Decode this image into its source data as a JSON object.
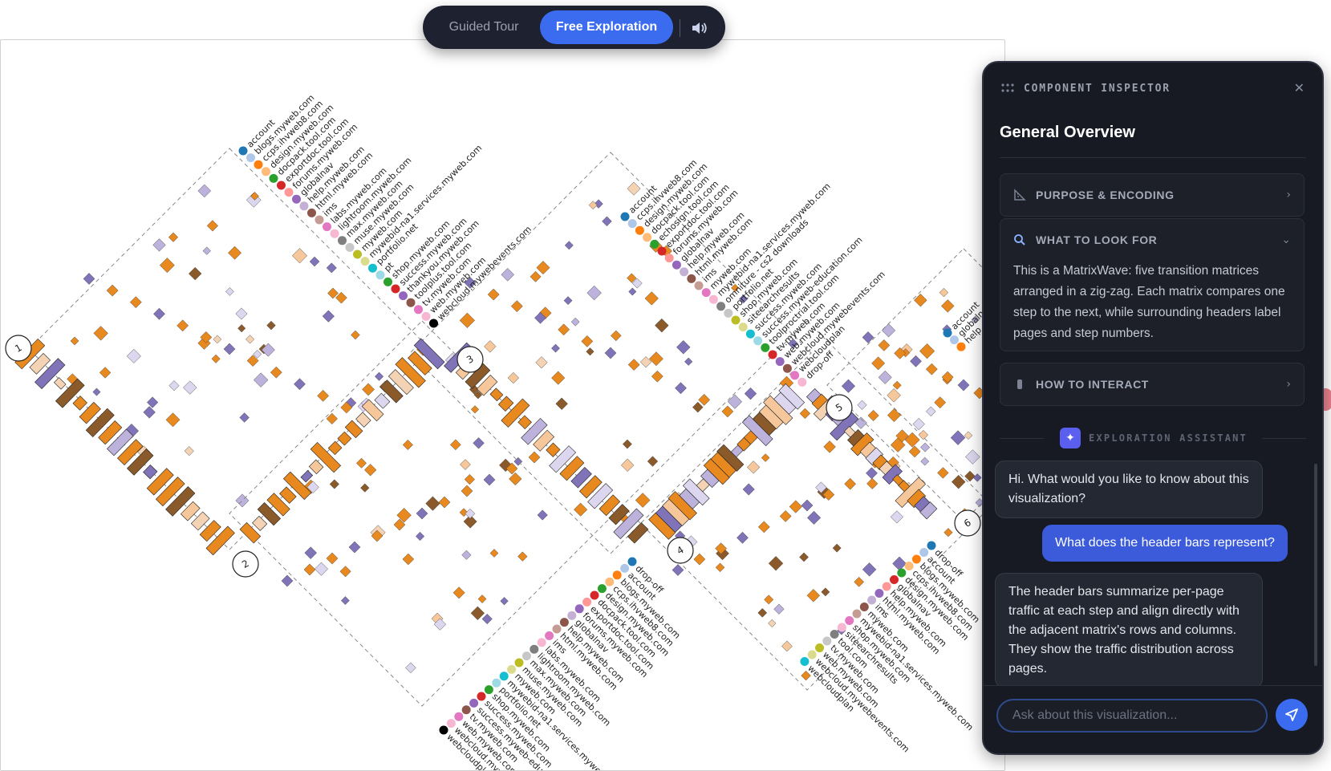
{
  "mode_switch": {
    "guided_label": "Guided Tour",
    "free_label": "Free Exploration",
    "active": "Free Exploration",
    "sound_icon": "speaker-icon"
  },
  "inspector": {
    "title": "COMPONENT INSPECTOR",
    "heading": "General Overview",
    "sections": [
      {
        "label": "PURPOSE & ENCODING",
        "icon": "ruler-icon",
        "expanded": false
      },
      {
        "label": "WHAT TO LOOK FOR",
        "icon": "search-icon",
        "expanded": true,
        "body": "This is a MatrixWave: five transition matrices arranged in a zig-zag. Each matrix compares one step to the next, while surrounding headers label pages and step numbers."
      },
      {
        "label": "HOW TO INTERACT",
        "icon": "hand-icon",
        "expanded": false
      }
    ],
    "assistant_label": "EXPLORATION ASSISTANT",
    "messages": [
      {
        "role": "assistant",
        "text": "Hi. What would you like to know about this visualization?"
      },
      {
        "role": "user",
        "text": "What does the header bars represent?"
      },
      {
        "role": "assistant",
        "text": "The header bars summarize per-page traffic at each step and align directly with the adjacent matrix's rows and columns. They show the traffic distribution across pages."
      }
    ],
    "input_placeholder": "Ask about this visualization..."
  },
  "visualization": {
    "type": "MatrixWave",
    "step_numbers": [
      "1",
      "2",
      "3",
      "4",
      "5",
      "6"
    ],
    "page_lists": [
      [
        "account",
        "blogs.myweb.com",
        "ccps.ihvweb8.com",
        "design.myweb.com",
        "docpack.tool.com",
        "exportdoc.tool.com",
        "forums.myweb.com",
        "globalnav",
        "help.myweb.com",
        "html.myweb.com",
        "ims",
        "labs.myweb.com",
        "lightroom.myweb.com",
        "max.myweb.com",
        "muse.myweb.com",
        "myweb.com",
        "mywebid-na1.services.myweb.com",
        "portfolio.net",
        "pt",
        "shop.myweb.com",
        "success.myweb.com",
        "thankyou.myweb.com",
        "toolplus.tool.com",
        "tv.myweb.com",
        "web.myweb.com",
        "webcloud.mywebevents.com"
      ],
      [
        "account",
        "ccps.ihvweb8.com",
        "design.myweb.com",
        "docpack.tool.com",
        "echosign.tool.com",
        "exportdoc.tool.com",
        "forums.myweb.com",
        "globalnav",
        "help.myweb.com",
        "html.myweb.com",
        "ims",
        "myweb.com",
        "mywebid-na1.services.myweb.com",
        "omniture - cs2 downloads",
        "portfolio.net",
        "shop.myweb.com",
        "siteearchresults",
        "success.myweb.com",
        "success.myweb-education.com",
        "toolproctrial.tool.com",
        "tv.myweb.com",
        "web.myweb.com",
        "webcloud.mywebevents.com",
        "webcloudplan",
        "drop-off"
      ],
      [
        "drop-off",
        "account",
        "blogs.myweb.com",
        "ccps.ihvweb8.com",
        "design.myweb.com",
        "docpack.tool.com",
        "exportdoc.tool.com",
        "forums.myweb.com",
        "globalnav",
        "help.myweb.com",
        "html.myweb.com",
        "ims",
        "labs.myweb.com",
        "lightroom.myweb.com",
        "max.myweb.com",
        "muse.myweb.com",
        "myweb.com",
        "mywebid-na1.services.myweb.com",
        "portfolio.net",
        "shop.myweb.com",
        "success.myweb.com",
        "success.myweb-education.com",
        "tv.myweb.com",
        "web.myweb.com",
        "webcloud.myweb.com",
        "webcloudplan"
      ],
      [
        "drop-off",
        "account",
        "blogs.myweb.com",
        "ccps.ihvweb8.com",
        "design.myweb.com",
        "globalnav",
        "help.myweb.com",
        "html.myweb.com",
        "ims",
        "myweb.com",
        "mywebid-na1.services.myweb.com",
        "shop.myweb.com",
        "siteearchresults",
        "tool.com",
        "tv.myweb.com",
        "web.myweb.com",
        "webcloud.mywebevents.com",
        "webcloudplan"
      ],
      [
        "account",
        "globalnav",
        "help"
      ]
    ],
    "colors": {
      "orange": "#e8891f",
      "light_orange": "#f6c79a",
      "peach": "#f4d3b5",
      "purple": "#8173b8",
      "light_purple": "#bcb2dc",
      "lavender": "#dcd6ef",
      "brown": "#8a5a2b",
      "grey": "#8d8d8d"
    }
  }
}
